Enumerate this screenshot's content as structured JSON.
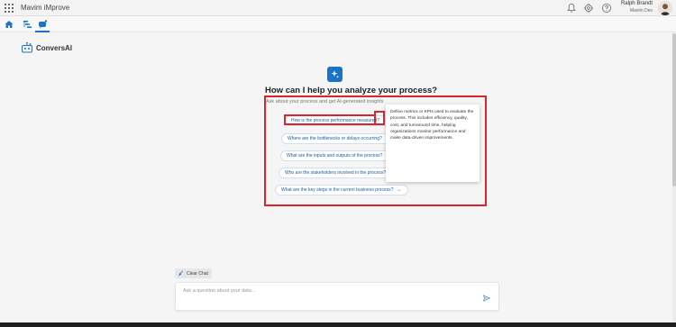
{
  "app": {
    "title": "Mavim iMprove"
  },
  "user": {
    "name": "Ralph Brandt",
    "role": "Mavim Dev"
  },
  "icons": {
    "apps": "grid-icon",
    "notifications": "bell-icon",
    "settings": "gear-icon",
    "help": "help-icon",
    "home": "home-icon",
    "process": "hierarchy-icon",
    "conversai": "ai-nav-icon",
    "send": "send-icon",
    "clear": "broom-icon"
  },
  "colors": {
    "accent": "#1a73c9",
    "annotation": "#d8262c",
    "chip_text": "#1a5fa8"
  },
  "conversai": {
    "brand_label": "ConversAI",
    "headline": "How can I help you analyze your process?",
    "subline": "Ask about your process and get AI-generated insights"
  },
  "suggestions": [
    {
      "label": "How is the process performance measured?",
      "arrow": "→"
    },
    {
      "label": "Where are the bottlenecks or delays occurring?",
      "arrow": "→"
    },
    {
      "label": "What are the inputs and outputs of the process?",
      "arrow": "→"
    },
    {
      "label": "Who are the stakeholders involved in the process?",
      "arrow": "→"
    },
    {
      "label": "What are the key steps in the current business process?",
      "arrow": "→"
    }
  ],
  "tooltip": {
    "text": "Define metrics or KPIs used to evaluate the process. This includes efficiency, quality, cost, and turnaround time, helping organizations monitor performance and make data-driven improvements."
  },
  "chat": {
    "clear_label": "Clear Chat",
    "placeholder": "Ask a question about your data..."
  }
}
